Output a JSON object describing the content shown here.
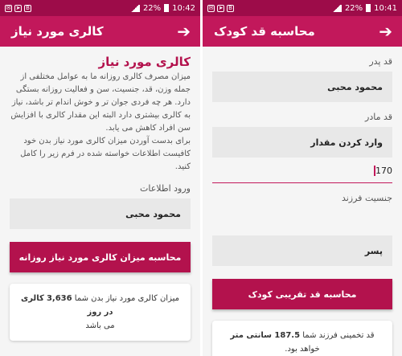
{
  "left": {
    "status": {
      "time": "10:42",
      "battery": "22%"
    },
    "toolbar": {
      "title": "کالری مورد نیاز"
    },
    "heading": "کالری مورد نیاز",
    "description": "میزان مصرف کالری روزانه ما به عوامل مختلفی از جمله وزن، قد، جنسیت، سن و فعالیت روزانه بستگی دارد. هر چه فردی جوان تر و خوش اندام تر باشد، نیاز به کالری بیشتری دارد البته این مقدار کالری با افزایش سن افراد کاهش می یابد.\nبرای بدست آوردن میزان کالری مورد نیاز بدن خود کافیست اطلاعات خواسته شده در فرم زیر را کامل کنید.",
    "input_label": "ورود اطلاعات",
    "name_value": "محمود محبی",
    "button_label": "محاسبه میزان کالری مورد نیاز روزانه",
    "result_prefix": "میزان کالری مورد نیاز بدن شما",
    "result_value": "3,636",
    "result_unit": "کالری در روز",
    "result_suffix": "می باشد"
  },
  "right": {
    "status": {
      "time": "10:41",
      "battery": "22%"
    },
    "toolbar": {
      "title": "محاسبه قد کودک"
    },
    "father_label": "قد پدر",
    "father_value": "محمود محبی",
    "mother_label": "قد مادر",
    "mother_placeholder": "وارد کردن مقدار",
    "mother_value": "170",
    "gender_label": "جنسیت فرزند",
    "gender_value": "پسر",
    "button_label": "محاسبه قد تقریبی کودک",
    "result_prefix": "قد تخمینی فرزند شما",
    "result_value": "187.5 سانتی متر",
    "result_suffix": "خواهد بود."
  },
  "icons": {
    "back": "arrow-right-icon"
  },
  "colors": {
    "statusbar": "#9d0c49",
    "toolbar": "#c2185b",
    "accent": "#b3124d"
  }
}
